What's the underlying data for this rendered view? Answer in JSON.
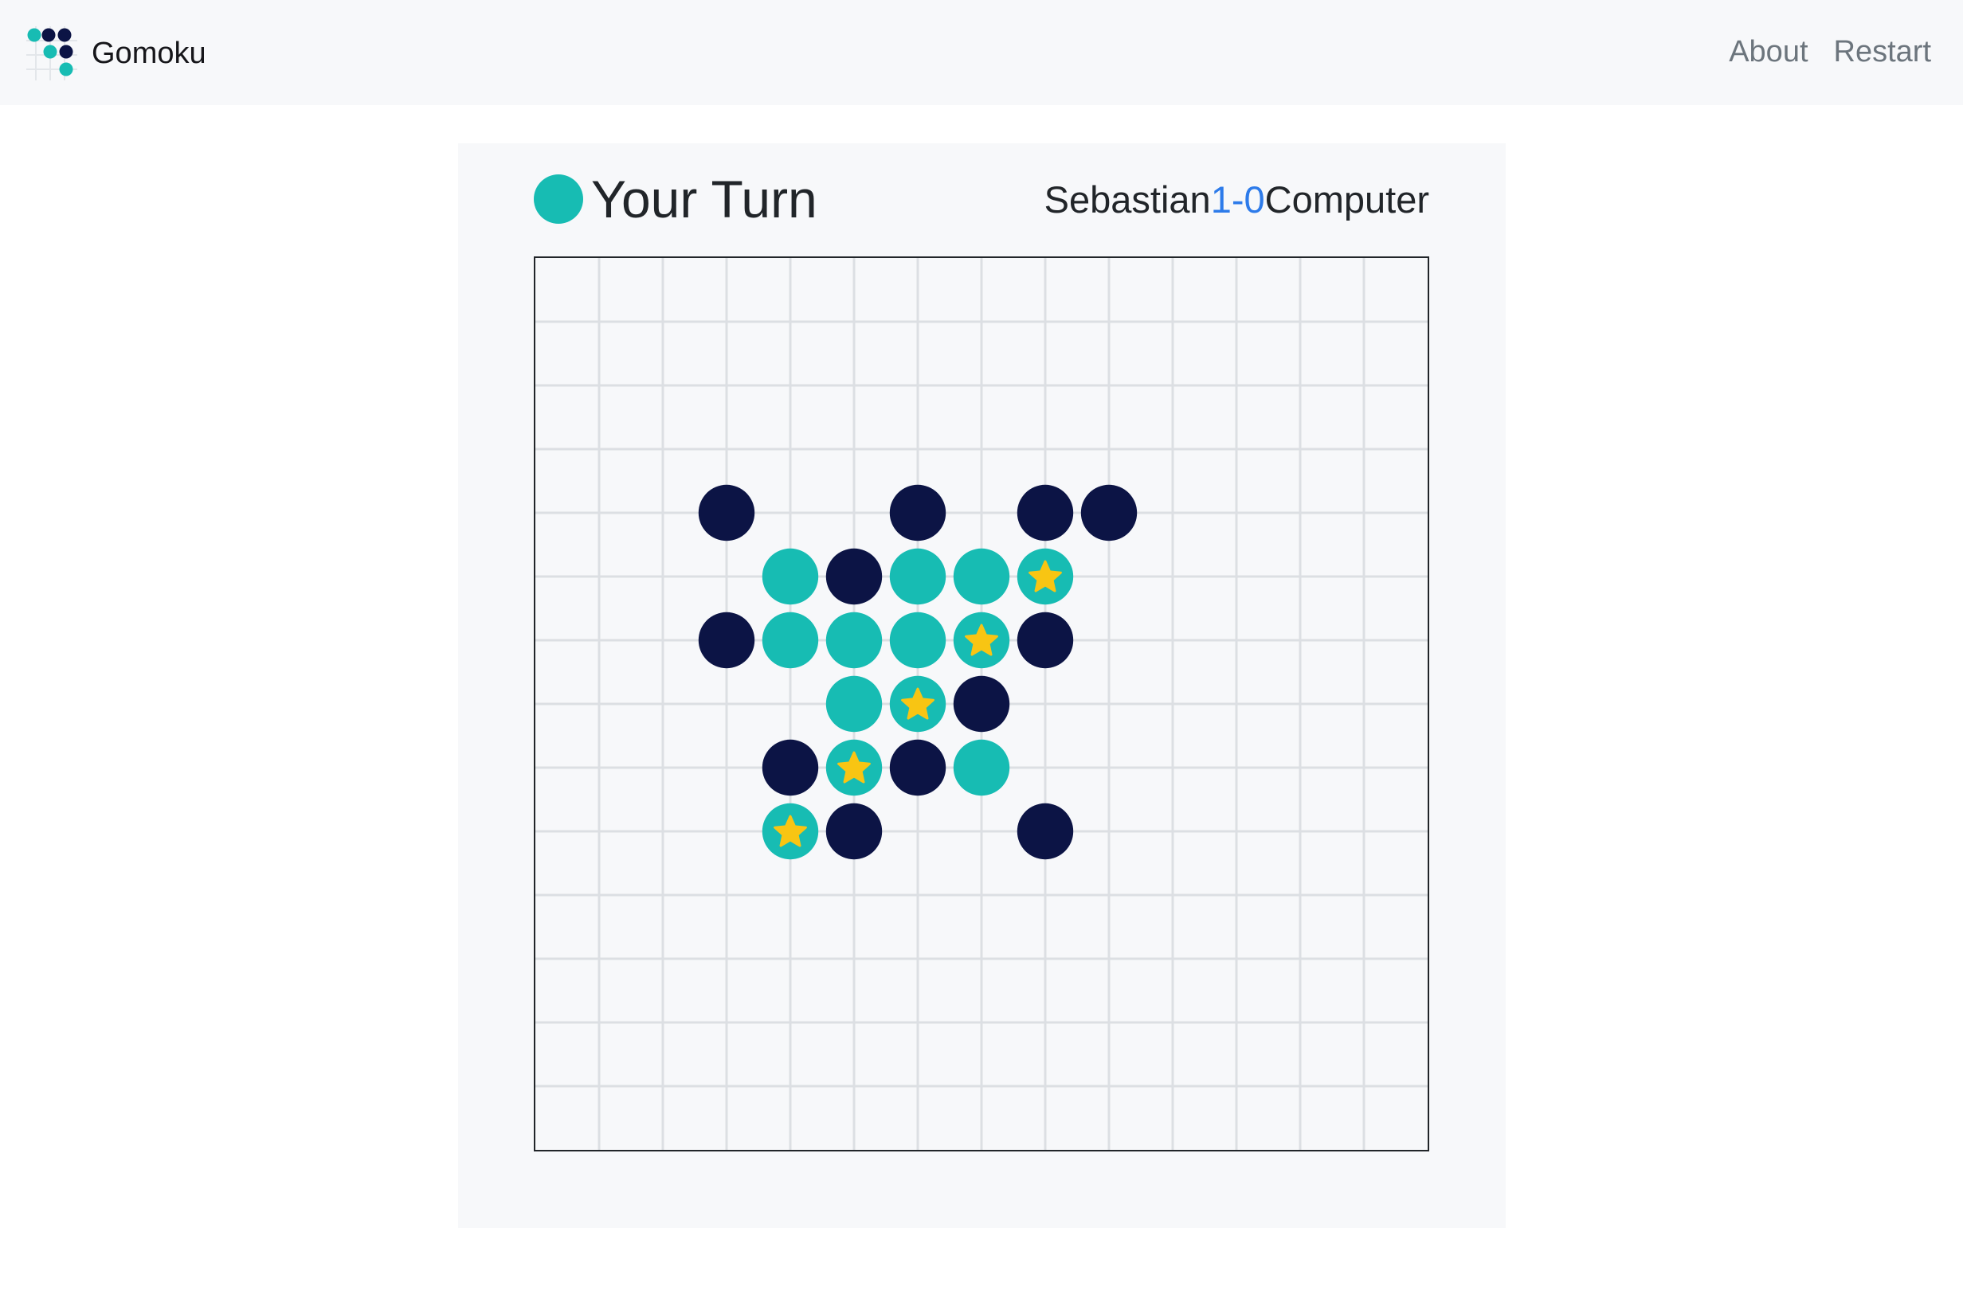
{
  "navbar": {
    "brand": "Gomoku",
    "links": [
      {
        "label": "About"
      },
      {
        "label": "Restart"
      }
    ]
  },
  "status": {
    "turn_text": "Your Turn",
    "turn_stone_icon": "teal-stone-icon"
  },
  "score": {
    "player_name": "Sebastian",
    "player_score": "1",
    "separator": "-",
    "computer_score": "0",
    "computer_name": "Computer"
  },
  "colors": {
    "player_stone": "#17bcb3",
    "computer_stone": "#0c1445",
    "win_star": "#f8c513",
    "grid_line": "#dcdfe3",
    "board_bg": "#f7f8fa",
    "score_accent": "#2d7bea"
  },
  "board": {
    "size": 14,
    "computer_stones": [
      [
        3,
        4
      ],
      [
        6,
        4
      ],
      [
        8,
        4
      ],
      [
        9,
        4
      ],
      [
        5,
        5
      ],
      [
        3,
        6
      ],
      [
        8,
        6
      ],
      [
        7,
        7
      ],
      [
        4,
        8
      ],
      [
        6,
        8
      ],
      [
        5,
        9
      ],
      [
        8,
        9
      ]
    ],
    "player_stones": [
      [
        4,
        5
      ],
      [
        6,
        5
      ],
      [
        7,
        5
      ],
      [
        8,
        5
      ],
      [
        4,
        6
      ],
      [
        5,
        6
      ],
      [
        6,
        6
      ],
      [
        7,
        6
      ],
      [
        5,
        7
      ],
      [
        6,
        7
      ],
      [
        5,
        8
      ],
      [
        7,
        8
      ],
      [
        4,
        9
      ]
    ],
    "winning_stones": [
      [
        8,
        5
      ],
      [
        7,
        6
      ],
      [
        6,
        7
      ],
      [
        5,
        8
      ],
      [
        4,
        9
      ]
    ]
  }
}
